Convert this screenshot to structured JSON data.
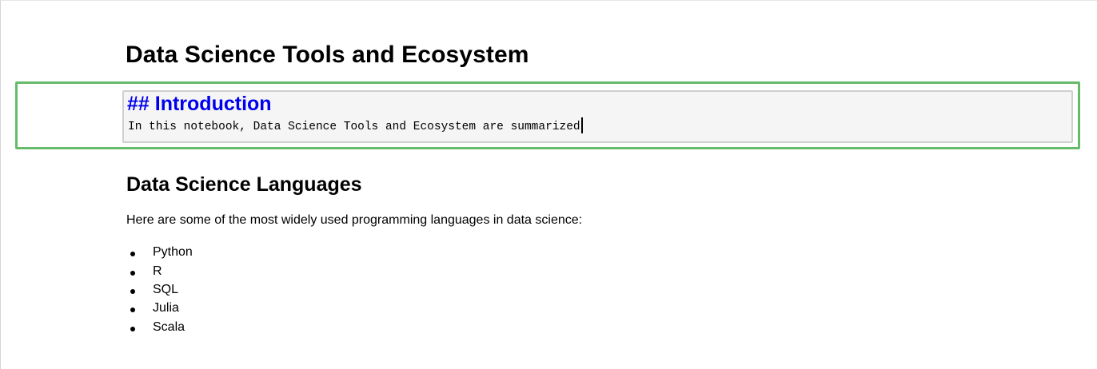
{
  "notebook": {
    "title": "Data Science Tools and Ecosystem",
    "active_cell": {
      "heading_source": "## Introduction",
      "body_source": "In this notebook, Data Science Tools and Ecosystem are summarized"
    },
    "section": {
      "heading": "Data Science Languages",
      "intro": "Here are some of the most widely used programming languages in data science:",
      "items": [
        {
          "label": "Python"
        },
        {
          "label": "R"
        },
        {
          "label": "SQL"
        },
        {
          "label": "Julia"
        },
        {
          "label": "Scala"
        }
      ]
    }
  },
  "colors": {
    "selected_cell_border": "#66bb6a",
    "editor_background": "#f5f5f5",
    "markdown_heading": "#0000ee"
  }
}
